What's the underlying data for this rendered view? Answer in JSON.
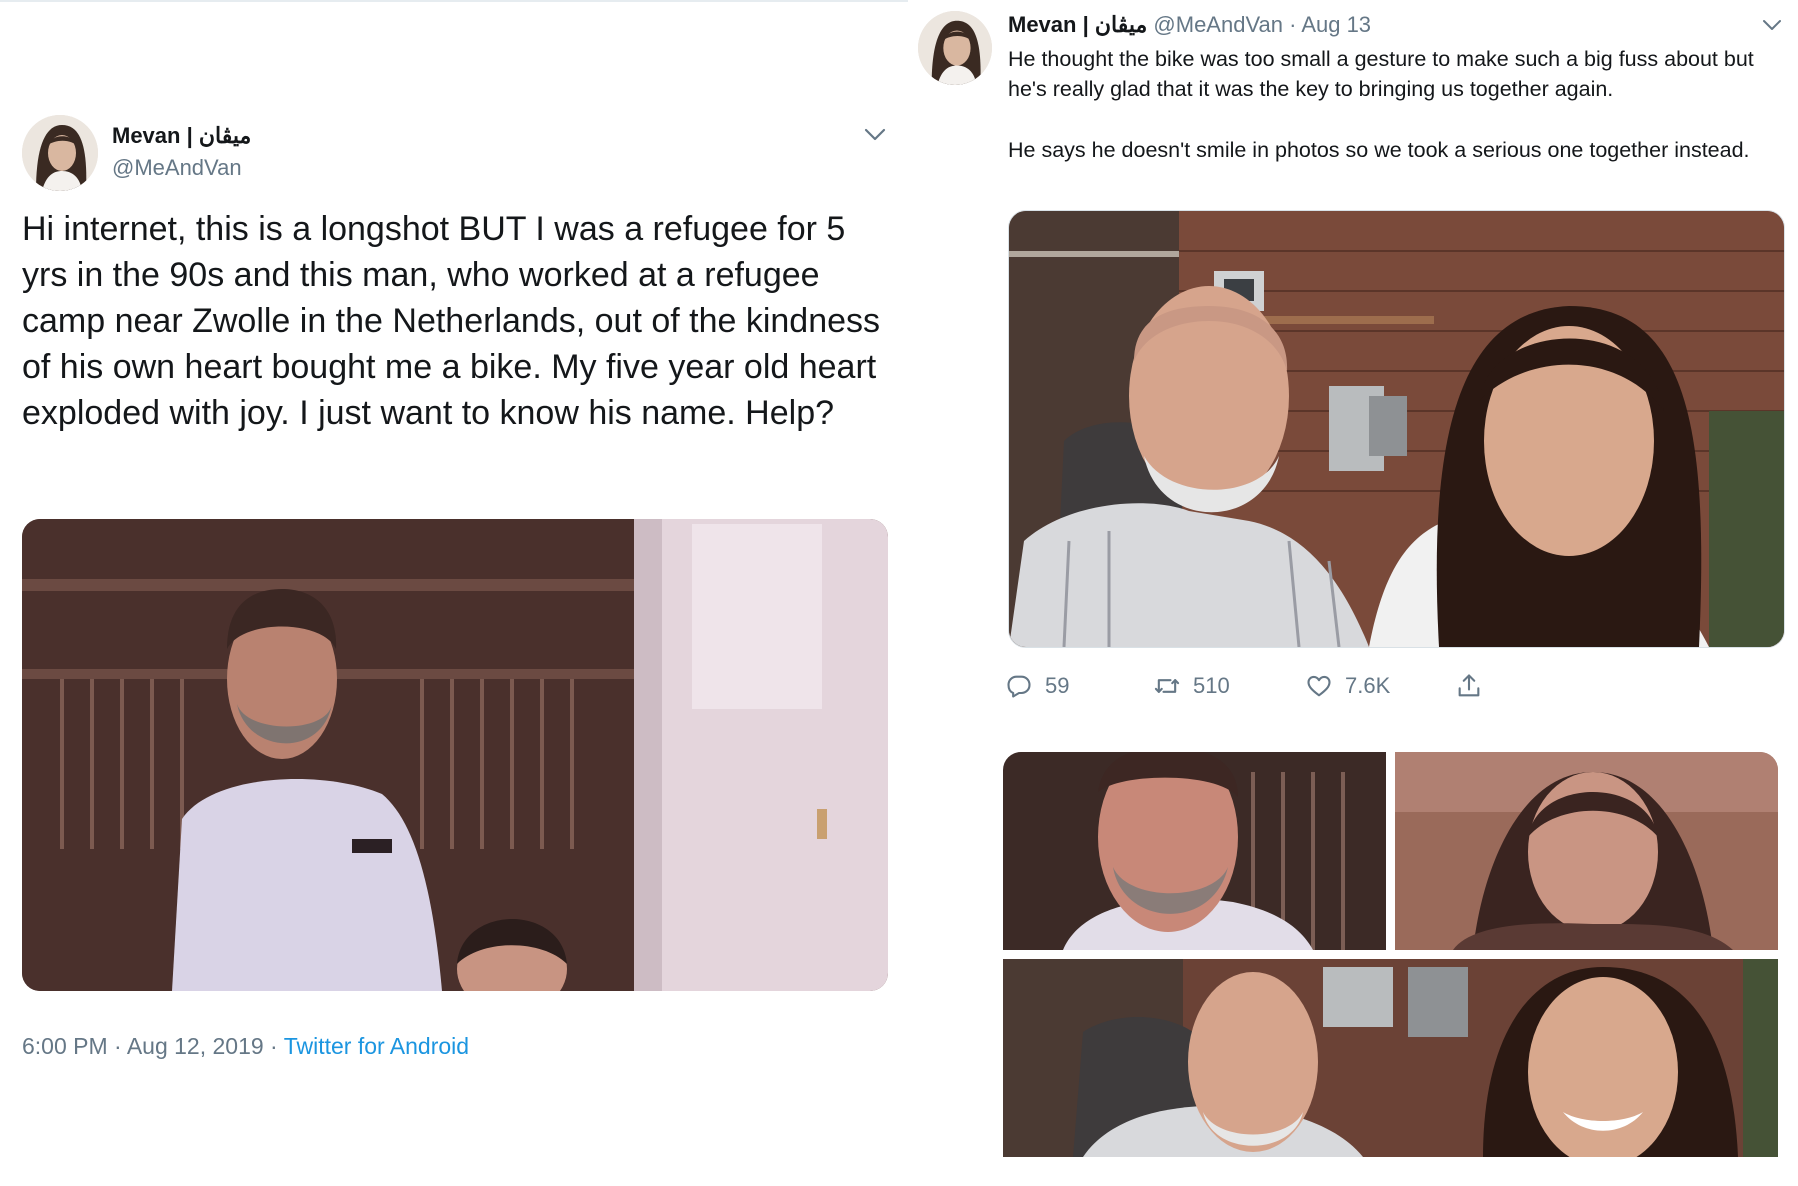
{
  "left_tweet": {
    "display_name": "Mevan | ميڤان",
    "handle": "@MeAndVan",
    "text": "Hi internet, this is a longshot BUT I was a refugee for 5 yrs in the 90s and this man, who worked at a refugee camp near Zwolle in the Netherlands, out of the kindness of his own heart bought me a bike. My five year old heart exploded with joy. I just want to know his name. Help?",
    "time": "6:00 PM",
    "sep1": " · ",
    "date": "Aug 12, 2019",
    "sep2": " · ",
    "source": "Twitter for Android"
  },
  "right_tweet": {
    "display_name": "Mevan | ميڤان",
    "handle": "@MeAndVan",
    "sep": " · ",
    "date": "Aug 13",
    "text_p1": "He thought the bike was too small a gesture to make such a big fuss about but he's really glad that it was the key to bringing us together again.",
    "text_p2": "He says he doesn't smile in photos so we took a serious one together instead.",
    "actions": {
      "replies": "59",
      "retweets": "510",
      "likes": "7.6K"
    }
  },
  "icons": {
    "reply": "reply-icon",
    "retweet": "retweet-icon",
    "like": "heart-icon",
    "share": "share-icon",
    "menu": "chevron-down-icon"
  },
  "colors": {
    "text": "#14171a",
    "secondary": "#657786",
    "link": "#1b95e0"
  }
}
